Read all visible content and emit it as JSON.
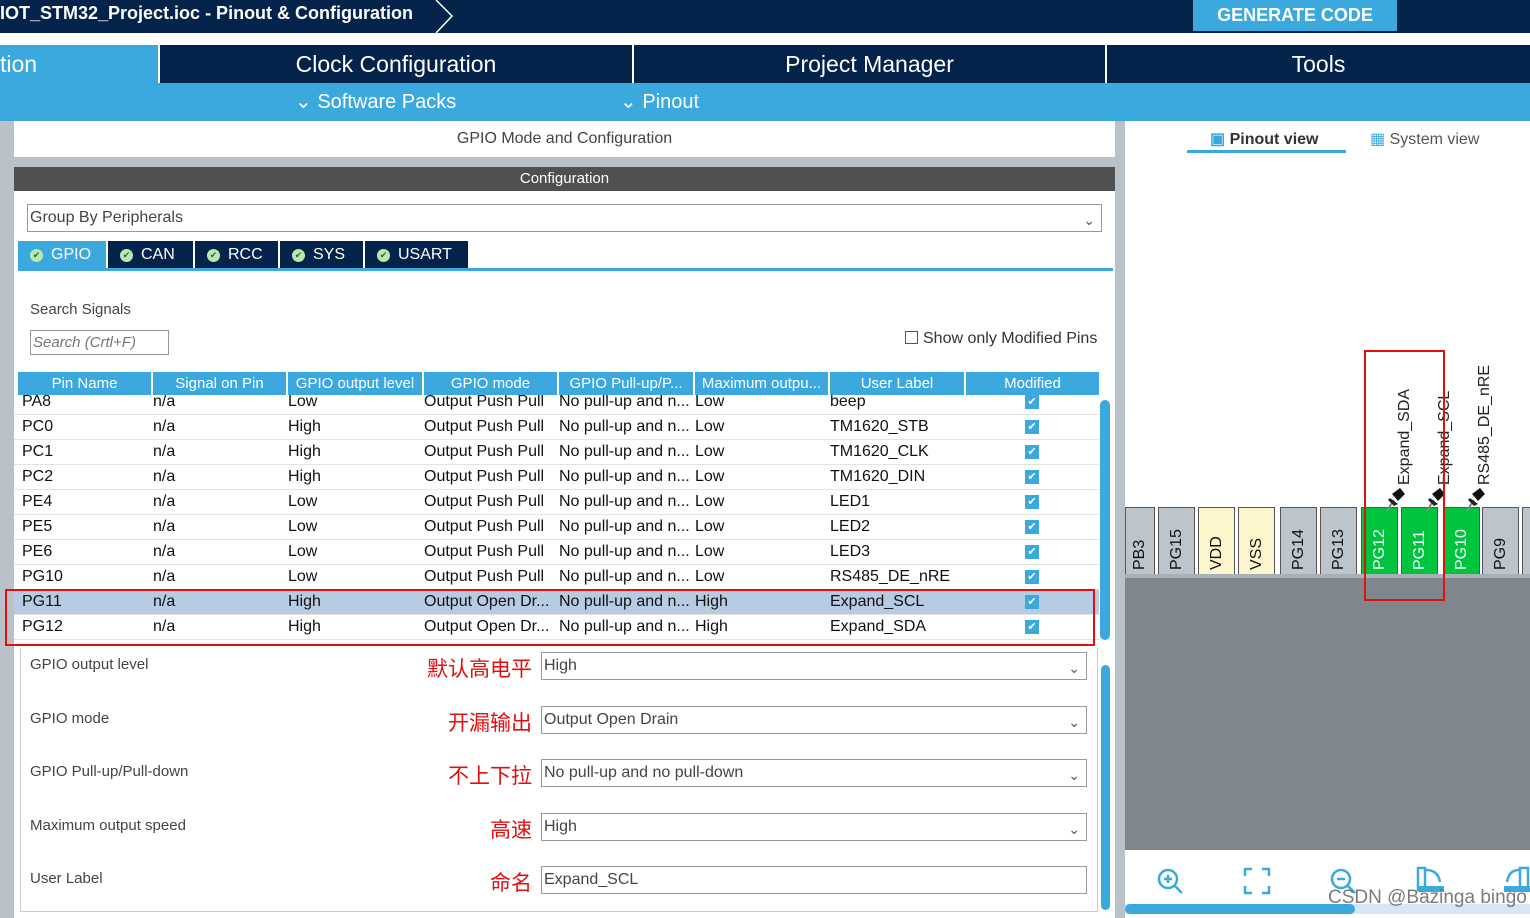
{
  "header": {
    "title": "IOT_STM32_Project.ioc - Pinout & Configuration",
    "generate_label": "GENERATE CODE"
  },
  "main_tabs": [
    {
      "label": "tion"
    },
    {
      "label": "Clock Configuration"
    },
    {
      "label": "Project Manager"
    },
    {
      "label": "Tools"
    }
  ],
  "sub_menu": [
    {
      "label": "Software Packs"
    },
    {
      "label": "Pinout"
    }
  ],
  "panel": {
    "title": "GPIO Mode and Configuration",
    "config_title": "Configuration",
    "group_by": "Group By Peripherals",
    "tabs": [
      {
        "label": "GPIO"
      },
      {
        "label": "CAN"
      },
      {
        "label": "RCC"
      },
      {
        "label": "SYS"
      },
      {
        "label": "USART"
      }
    ],
    "search_label": "Search Signals",
    "search_placeholder": "Search (Crtl+F)",
    "show_modified_label": "Show only Modified Pins"
  },
  "table": {
    "columns": [
      "Pin Name",
      "Signal on Pin",
      "GPIO output level",
      "GPIO mode",
      "GPIO Pull-up/P...",
      "Maximum outpu...",
      "User Label",
      "Modified"
    ],
    "rows": [
      [
        "PA8",
        "n/a",
        "Low",
        "Output Push Pull",
        "No pull-up and n...",
        "Low",
        "beep"
      ],
      [
        "PC0",
        "n/a",
        "High",
        "Output Push Pull",
        "No pull-up and n...",
        "Low",
        "TM1620_STB"
      ],
      [
        "PC1",
        "n/a",
        "High",
        "Output Push Pull",
        "No pull-up and n...",
        "Low",
        "TM1620_CLK"
      ],
      [
        "PC2",
        "n/a",
        "High",
        "Output Push Pull",
        "No pull-up and n...",
        "Low",
        "TM1620_DIN"
      ],
      [
        "PE4",
        "n/a",
        "Low",
        "Output Push Pull",
        "No pull-up and n...",
        "Low",
        "LED1"
      ],
      [
        "PE5",
        "n/a",
        "Low",
        "Output Push Pull",
        "No pull-up and n...",
        "Low",
        "LED2"
      ],
      [
        "PE6",
        "n/a",
        "Low",
        "Output Push Pull",
        "No pull-up and n...",
        "Low",
        "LED3"
      ],
      [
        "PG10",
        "n/a",
        "Low",
        "Output Push Pull",
        "No pull-up and n...",
        "Low",
        "RS485_DE_nRE"
      ],
      [
        "PG11",
        "n/a",
        "High",
        "Output Open Dr...",
        "No pull-up and n...",
        "High",
        "Expand_SCL"
      ],
      [
        "PG12",
        "n/a",
        "High",
        "Output Open Dr...",
        "No pull-up and n...",
        "High",
        "Expand_SDA"
      ]
    ],
    "selected_row": "PG11"
  },
  "properties": [
    {
      "label": "GPIO output level",
      "note": "默认高电平",
      "value": "High"
    },
    {
      "label": "GPIO mode",
      "note": "开漏输出",
      "value": "Output Open Drain"
    },
    {
      "label": "GPIO Pull-up/Pull-down",
      "note": "不上下拉",
      "value": "No pull-up and no pull-down"
    },
    {
      "label": "Maximum output speed",
      "note": "高速",
      "value": "High"
    },
    {
      "label": "User Label",
      "note": "命名",
      "value": "Expand_SCL"
    }
  ],
  "right": {
    "pinout_view": "Pinout view",
    "system_view": "System view",
    "pins": [
      {
        "name": "PB3",
        "type": "gray"
      },
      {
        "name": "PG15",
        "type": "gray"
      },
      {
        "name": "VDD",
        "type": "power"
      },
      {
        "name": "VSS",
        "type": "power"
      },
      {
        "name": "PG14",
        "type": "gray"
      },
      {
        "name": "PG13",
        "type": "gray"
      },
      {
        "name": "PG12",
        "type": "green"
      },
      {
        "name": "PG11",
        "type": "green"
      },
      {
        "name": "PG10",
        "type": "green"
      },
      {
        "name": "PG9",
        "type": "gray"
      }
    ],
    "pin_labels": [
      "Expand_SDA",
      "Expand_SCL",
      "RS485_DE_nRE"
    ],
    "toolbar_icons": [
      "zoom-in-icon",
      "fit-icon",
      "zoom-out-icon",
      "rotate-right-icon",
      "rotate-left-icon"
    ]
  },
  "watermark": "CSDN @Bazinga bingo",
  "colors": {
    "navy": "#03234b",
    "accent": "#3ba9dd",
    "pin_green": "#00c43d",
    "highlight": "#e01010"
  }
}
